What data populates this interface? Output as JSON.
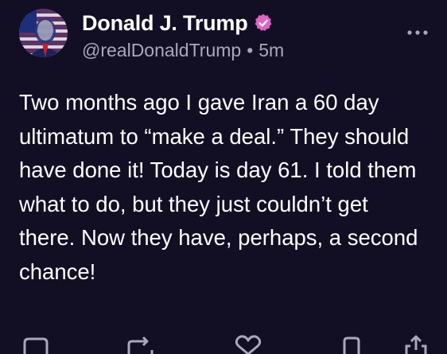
{
  "author": {
    "display_name": "Donald J. Trump",
    "handle": "@realDonaldTrump",
    "time_ago": "5m",
    "separator": "•",
    "verified_icon": "verified-badge-icon",
    "verified_color": "#e063c4"
  },
  "post": {
    "text": "Two months ago I gave Iran a 60 day ultimatum to “make a deal.” They should have done it! Today is day 61. I told them what to do, but they just couldn’t get there. Now they have, perhaps, a second chance!"
  },
  "actions": {
    "icons": [
      "reply-icon",
      "retruth-icon",
      "like-icon",
      "bookmark-icon",
      "share-icon"
    ]
  },
  "colors": {
    "background": "#120f25",
    "text": "#ffffff",
    "secondary_text": "#aaa7bd",
    "icon": "#aaa7bd"
  }
}
